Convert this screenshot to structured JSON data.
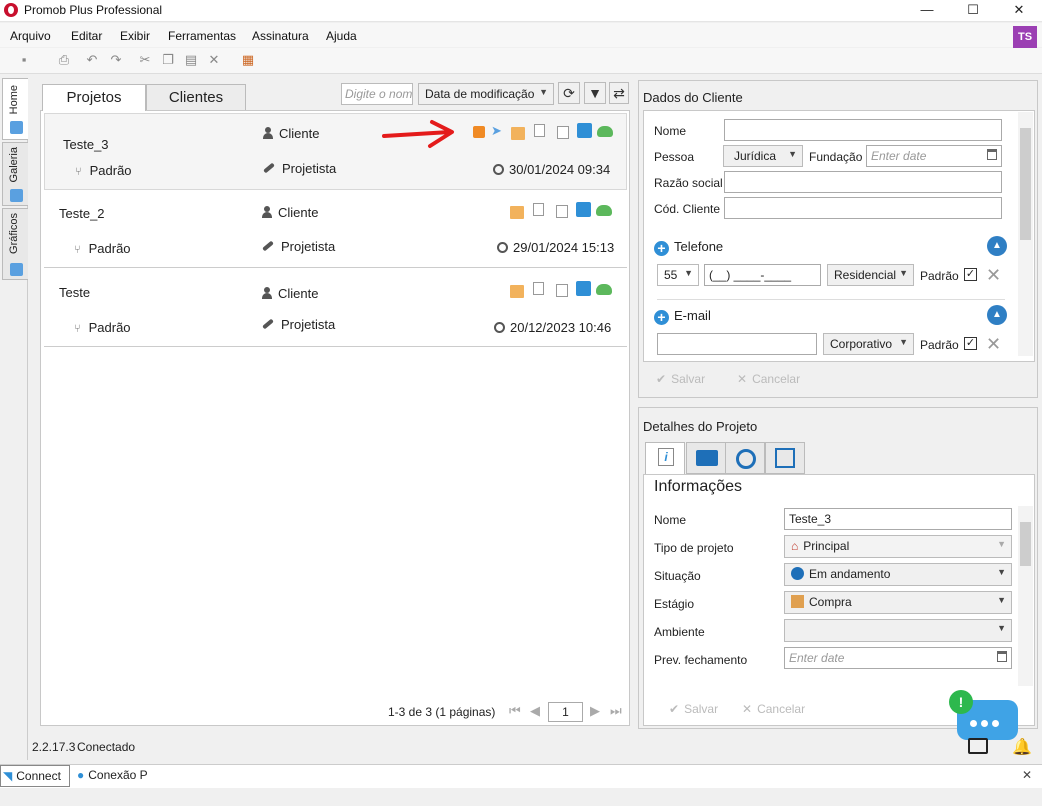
{
  "window": {
    "title": "Promob Plus Professional",
    "minimize": "—",
    "maximize": "☐",
    "close": "✕",
    "user_badge": "TS"
  },
  "menu": [
    "Arquivo",
    "Editar",
    "Exibir",
    "Ferramentas",
    "Assinatura",
    "Ajuda"
  ],
  "toolbar_icons": [
    "save-icon",
    "print-icon",
    "undo-icon",
    "redo-icon",
    "cut-icon",
    "copy-icon",
    "paste-icon",
    "delete-icon",
    "palette-icon"
  ],
  "sidebar": {
    "tabs": [
      {
        "label": "Home",
        "icon": "home-icon"
      },
      {
        "label": "Galeria",
        "icon": "gallery-icon"
      },
      {
        "label": "Gráficos",
        "icon": "charts-icon"
      }
    ]
  },
  "projects_panel": {
    "tabs": [
      "Projetos",
      "Clientes"
    ],
    "search_placeholder": "Digite o nome",
    "sort": "Data de modificação",
    "items": [
      {
        "name": "Teste_3",
        "version": "Padrão",
        "client": "Cliente",
        "designer": "Projetista",
        "date": "30/01/2024 09:34"
      },
      {
        "name": "Teste_2",
        "version": "Padrão",
        "client": "Cliente",
        "designer": "Projetista",
        "date": "29/01/2024 15:13"
      },
      {
        "name": "Teste",
        "version": "Padrão",
        "client": "Cliente",
        "designer": "Projetista",
        "date": "20/12/2023 10:46"
      }
    ],
    "pager": {
      "summary": "1-3 de 3 (1 páginas)",
      "page": "1"
    }
  },
  "client_panel": {
    "title": "Dados do Cliente",
    "labels": {
      "nome": "Nome",
      "pessoa": "Pessoa",
      "fundacao": "Fundação",
      "razao": "Razão social",
      "codigo": "Cód. Cliente"
    },
    "pessoa_value": "Jurídica",
    "date_placeholder": "Enter date",
    "telefone": {
      "title": "Telefone",
      "ddd": "55",
      "mask": "(__) ____-____",
      "type": "Residencial",
      "default_label": "Padrão",
      "checked": "✓"
    },
    "email": {
      "title": "E-mail",
      "type": "Corporativo",
      "default_label": "Padrão",
      "checked": "✓"
    },
    "save": "Salvar",
    "cancel": "Cancelar"
  },
  "details_panel": {
    "title": "Detalhes do Projeto",
    "section": "Informações",
    "fields": {
      "nome": {
        "label": "Nome",
        "value": "Teste_3"
      },
      "tipo": {
        "label": "Tipo de projeto",
        "value": "Principal"
      },
      "situacao": {
        "label": "Situação",
        "value": "Em andamento"
      },
      "estagio": {
        "label": "Estágio",
        "value": "Compra"
      },
      "ambiente": {
        "label": "Ambiente",
        "value": ""
      },
      "fechamento": {
        "label": "Prev. fechamento",
        "placeholder": "Enter date"
      }
    },
    "save": "Salvar",
    "cancel": "Cancelar"
  },
  "status": {
    "version": "2.2.17.3",
    "connection": "Conectado"
  },
  "taskbar": {
    "items": [
      "Connect",
      "Conexão P"
    ],
    "close": "✕"
  },
  "chat": {
    "badge": "!"
  },
  "colors": {
    "accent_blue": "#2f8fd6",
    "annotation_red": "#e41b1b",
    "brand_red": "#c8102e",
    "badge_purple": "#9b3fb3"
  }
}
